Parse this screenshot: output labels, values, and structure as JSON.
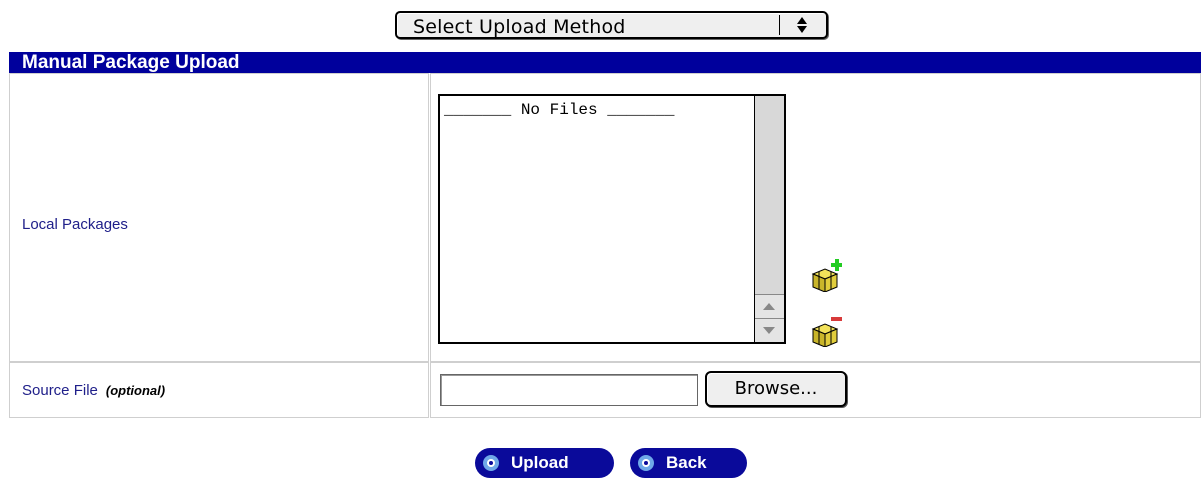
{
  "upload_method": {
    "selected": "Select Upload Method"
  },
  "section": {
    "title": "Manual Package Upload"
  },
  "local_packages": {
    "label": "Local Packages",
    "list_placeholder": "_______ No Files _______",
    "add_icon": "package-add-icon",
    "remove_icon": "package-remove-icon"
  },
  "source_file": {
    "label": "Source File",
    "optional": "(optional)",
    "value": "",
    "browse_label": "Browse..."
  },
  "actions": {
    "upload_label": "Upload",
    "back_label": "Back"
  },
  "colors": {
    "header": "#00009c",
    "button": "#0a0a9a",
    "label_text": "#20208a"
  }
}
